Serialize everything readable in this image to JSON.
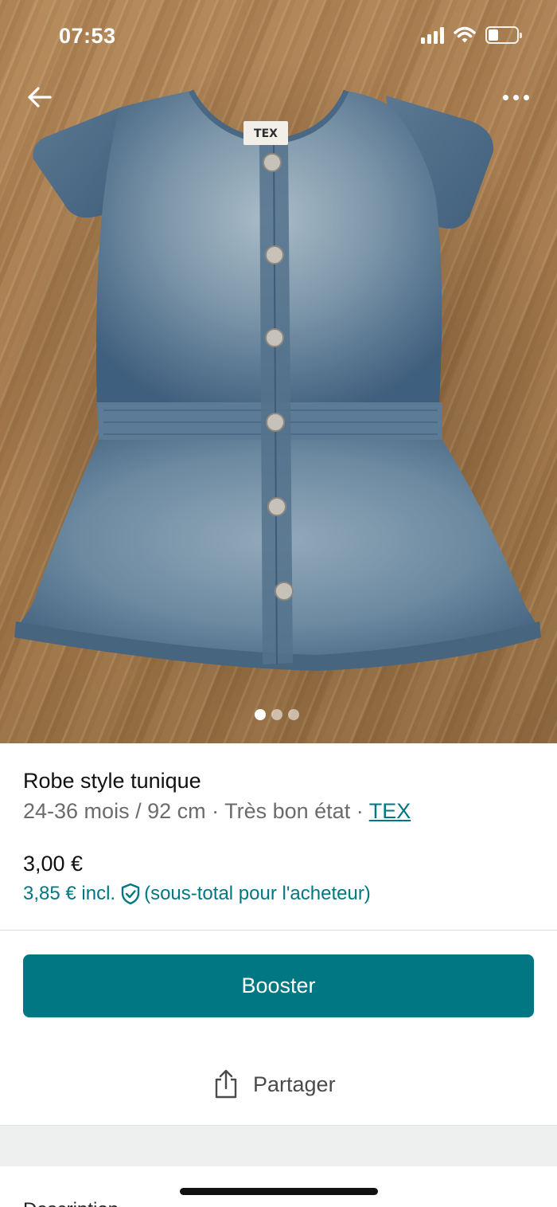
{
  "status_bar": {
    "time": "07:53"
  },
  "listing": {
    "title": "Robe style tunique",
    "size": "24-36 mois / 92 cm",
    "separator": " · ",
    "condition": "Très bon état",
    "brand": "TEX",
    "price": "3,00 €",
    "price_incl": "3,85 € incl.",
    "price_note": "(sous-total pour l'acheteur)"
  },
  "photo": {
    "label_brand": "TEX",
    "current_index": 1,
    "count": 3
  },
  "actions": {
    "booster_label": "Booster",
    "share_label": "Partager"
  },
  "bottom_section": {
    "label": "Description"
  },
  "colors": {
    "accent": "#007782",
    "button_text": "#ffffff"
  }
}
